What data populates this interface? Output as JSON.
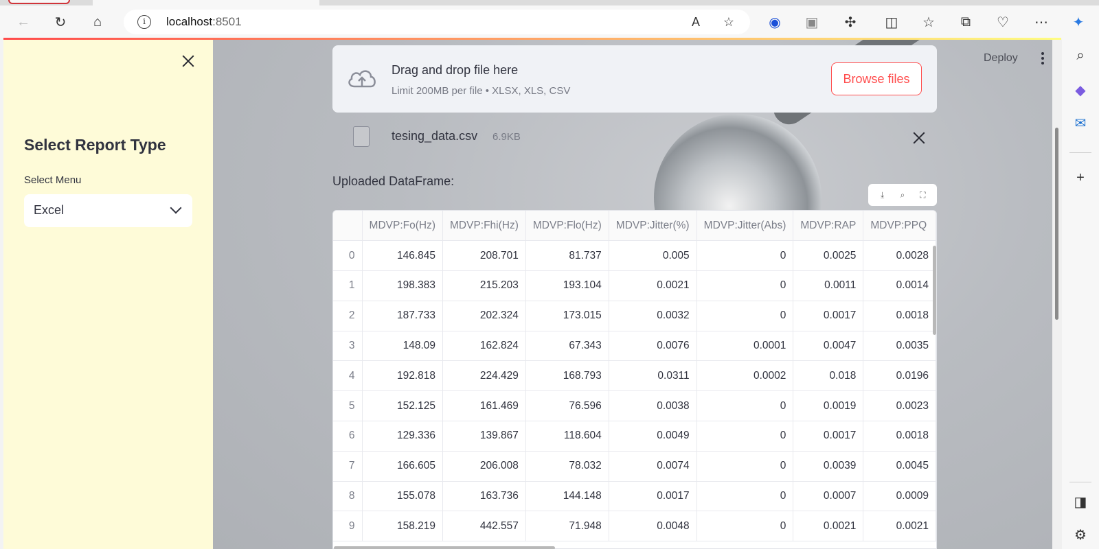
{
  "browser": {
    "url_host": "localhost",
    "url_port": ":8501"
  },
  "header": {
    "deploy_label": "Deploy"
  },
  "sidebar": {
    "title": "Select Report Type",
    "select_label": "Select Menu",
    "select_value": "Excel"
  },
  "uploader": {
    "title": "Drag and drop file here",
    "subtitle": "Limit 200MB per file • XLSX, XLS, CSV",
    "browse_label": "Browse files",
    "file_name": "tesing_data.csv",
    "file_size": "6.9KB"
  },
  "dataframe": {
    "label": "Uploaded DataFrame:",
    "columns": [
      "",
      "MDVP:Fo(Hz)",
      "MDVP:Fhi(Hz)",
      "MDVP:Flo(Hz)",
      "MDVP:Jitter(%)",
      "MDVP:Jitter(Abs)",
      "MDVP:RAP",
      "MDVP:PPQ"
    ],
    "rows": [
      [
        "0",
        "146.845",
        "208.701",
        "81.737",
        "0.005",
        "0",
        "0.0025",
        "0.0028"
      ],
      [
        "1",
        "198.383",
        "215.203",
        "193.104",
        "0.0021",
        "0",
        "0.0011",
        "0.0014"
      ],
      [
        "2",
        "187.733",
        "202.324",
        "173.015",
        "0.0032",
        "0",
        "0.0017",
        "0.0018"
      ],
      [
        "3",
        "148.09",
        "162.824",
        "67.343",
        "0.0076",
        "0.0001",
        "0.0047",
        "0.0035"
      ],
      [
        "4",
        "192.818",
        "224.429",
        "168.793",
        "0.0311",
        "0.0002",
        "0.018",
        "0.0196"
      ],
      [
        "5",
        "152.125",
        "161.469",
        "76.596",
        "0.0038",
        "0",
        "0.0019",
        "0.0023"
      ],
      [
        "6",
        "129.336",
        "139.867",
        "118.604",
        "0.0049",
        "0",
        "0.0017",
        "0.0018"
      ],
      [
        "7",
        "166.605",
        "206.008",
        "78.032",
        "0.0074",
        "0",
        "0.0039",
        "0.0045"
      ],
      [
        "8",
        "155.078",
        "163.736",
        "144.148",
        "0.0017",
        "0",
        "0.0007",
        "0.0009"
      ],
      [
        "9",
        "158.219",
        "442.557",
        "71.948",
        "0.0048",
        "0",
        "0.0021",
        "0.0021"
      ]
    ]
  },
  "colors": {
    "accent": "#ff4b4b",
    "sidebar_bg": "#fefbd8"
  }
}
